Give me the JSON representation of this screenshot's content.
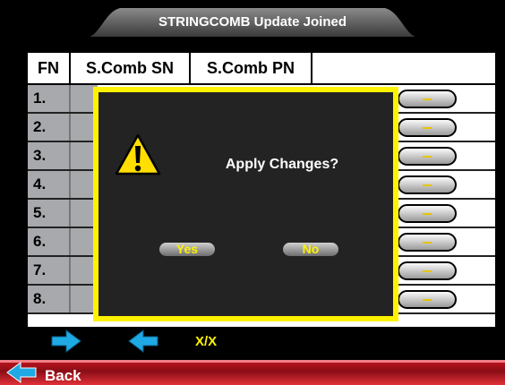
{
  "title": "STRINGCOMB Update Joined",
  "table": {
    "headers": {
      "fn": "FN",
      "sn": "S.Comb SN",
      "pn": "S.Comb PN"
    },
    "rows": [
      "1.",
      "2.",
      "3.",
      "4.",
      "5.",
      "6.",
      "7.",
      "8."
    ],
    "action_button_icon": "minus-icon"
  },
  "dialog": {
    "icon": "warning-icon",
    "message": "Apply Changes?",
    "yes_label": "Yes",
    "no_label": "No"
  },
  "navigation": {
    "next_icon": "arrow-right-icon",
    "prev_icon": "arrow-left-icon",
    "page_indicator": "X/X"
  },
  "footer": {
    "back_icon": "arrow-left-icon",
    "back_label": "Back"
  },
  "colors": {
    "accent_yellow": "#fff200",
    "arrow_blue": "#1fa9e4",
    "back_red": "#c31520"
  }
}
